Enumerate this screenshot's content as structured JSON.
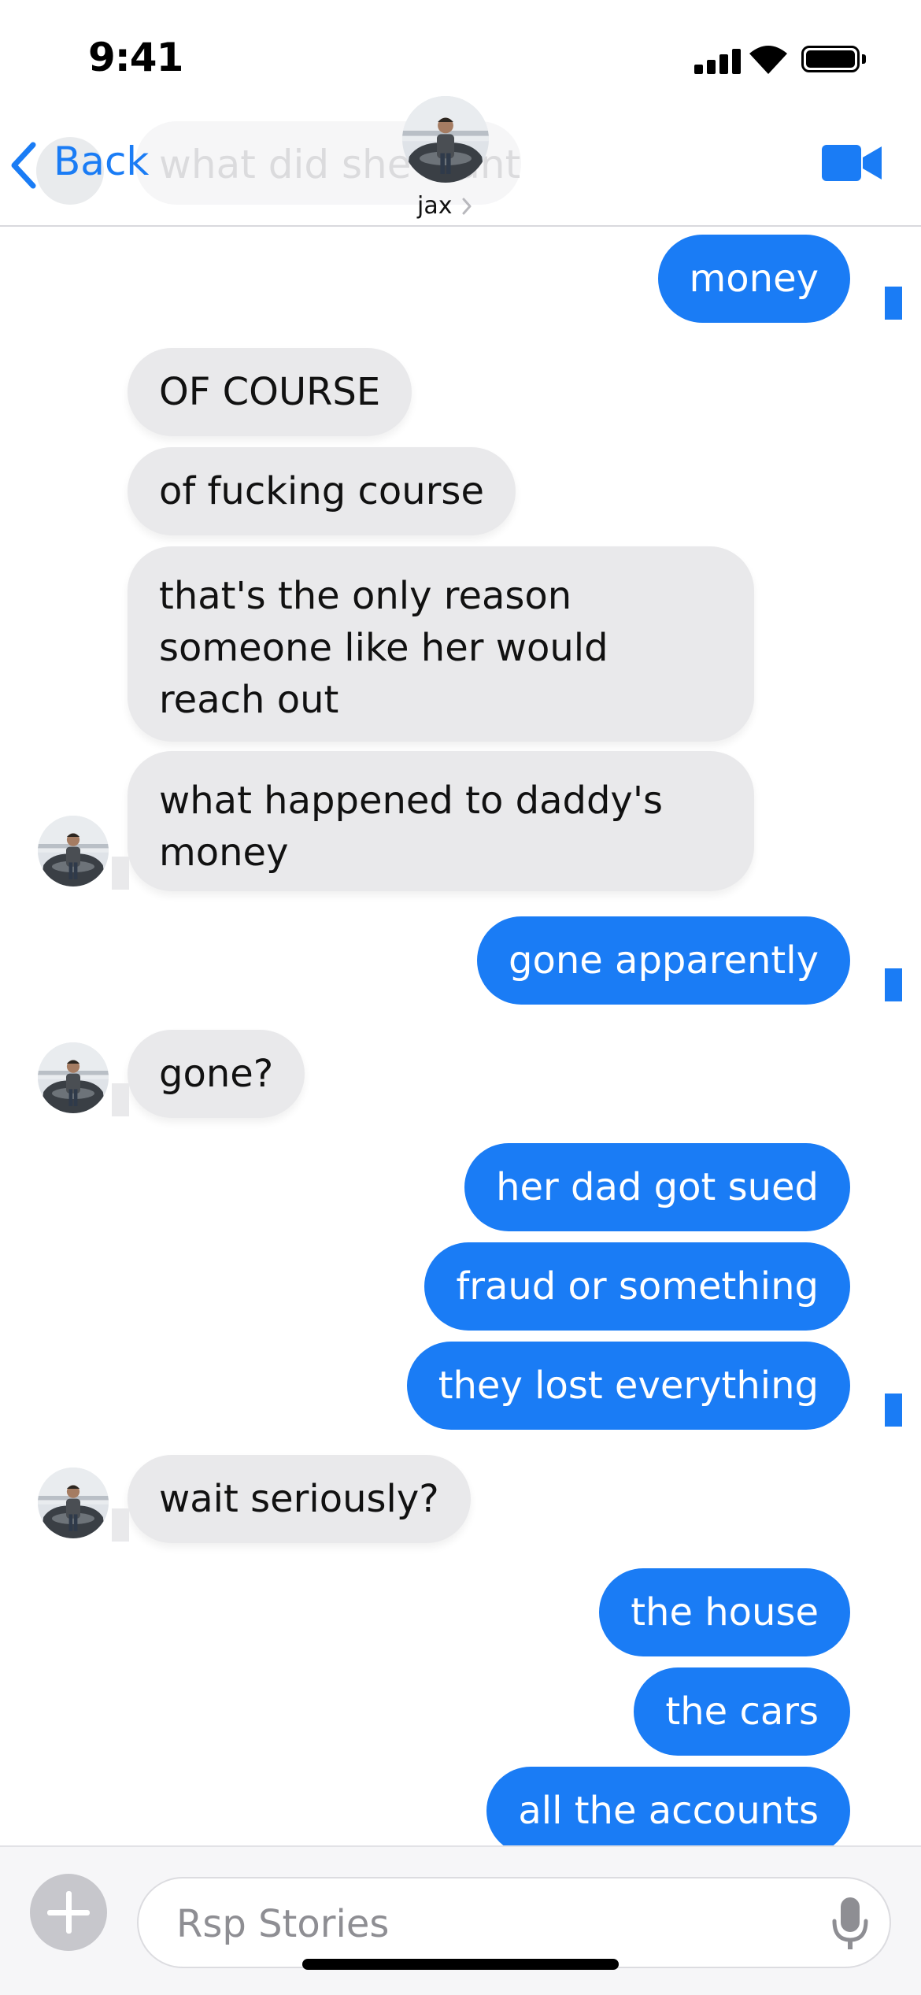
{
  "status_bar": {
    "time": "9:41"
  },
  "header": {
    "back_label": "Back",
    "contact_name": "jax",
    "ghost_preview": "what did she want"
  },
  "messages": [
    {
      "sender": "me",
      "text": "money"
    },
    {
      "sender": "jax",
      "text": "OF COURSE"
    },
    {
      "sender": "jax",
      "text": "of fucking course"
    },
    {
      "sender": "jax",
      "text": "that's the only reason someone like her would reach out"
    },
    {
      "sender": "jax",
      "text": "what happened to daddy's money"
    },
    {
      "sender": "me",
      "text": "gone apparently"
    },
    {
      "sender": "jax",
      "text": "gone?"
    },
    {
      "sender": "me",
      "text": "her dad got sued"
    },
    {
      "sender": "me",
      "text": "fraud or something"
    },
    {
      "sender": "me",
      "text": "they lost everything"
    },
    {
      "sender": "jax",
      "text": "wait seriously?"
    },
    {
      "sender": "me",
      "text": "the house"
    },
    {
      "sender": "me",
      "text": "the cars"
    },
    {
      "sender": "me",
      "text": "all the accounts"
    }
  ],
  "input": {
    "placeholder": "Rsp Stories"
  },
  "icons": {
    "back": "chevron-left-icon",
    "video": "video-camera-icon",
    "add": "plus-icon",
    "mic": "microphone-icon"
  },
  "colors": {
    "outgoing_bubble": "#1a7cf5",
    "incoming_bubble": "#e9e9eb",
    "accent": "#1a7cf5"
  }
}
